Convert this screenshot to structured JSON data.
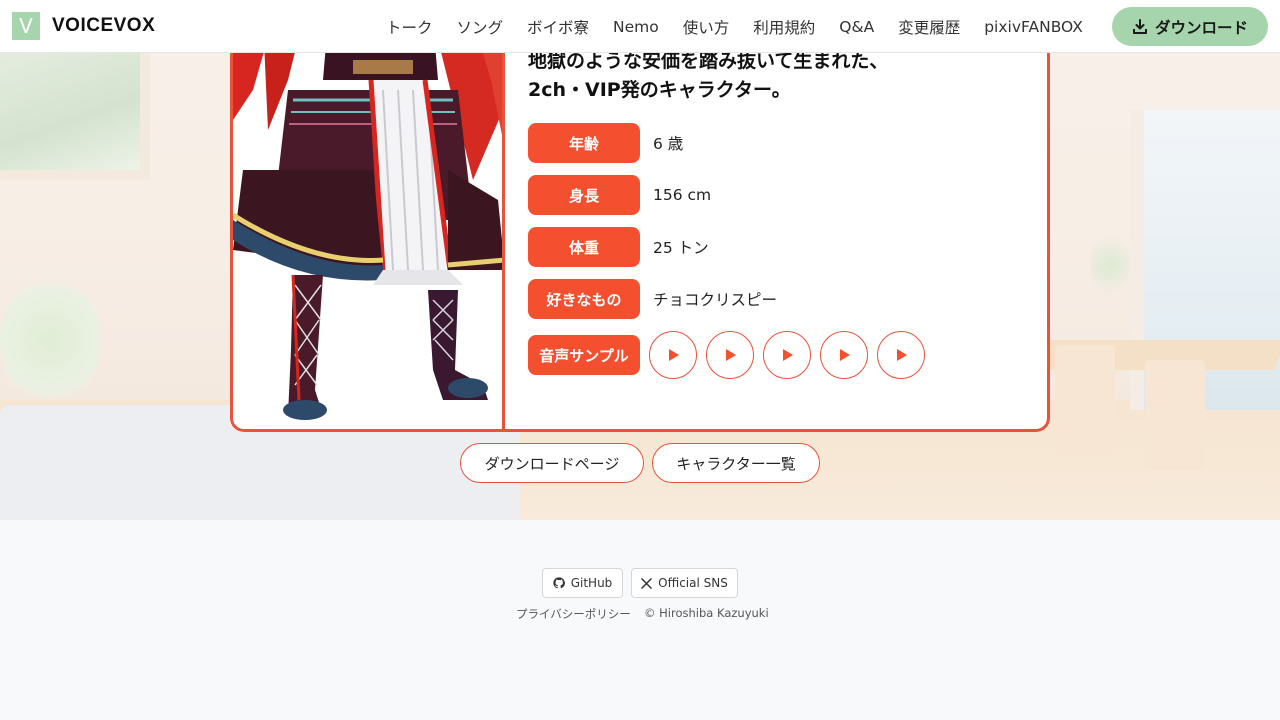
{
  "header": {
    "logo_letter": "V",
    "logo_text": "VOICEVOX",
    "nav": [
      "トーク",
      "ソング",
      "ボイボ寮",
      "Nemo",
      "使い方",
      "利用規約",
      "Q&A",
      "変更履歴",
      "pixivFANBOX"
    ],
    "download_label": "ダウンロード"
  },
  "character": {
    "intro_line1": "地獄のような安価を踏み抜いて生まれた、",
    "intro_line2": "2ch・VIP発のキャラクター。",
    "rows": [
      {
        "label": "年齢",
        "value": "6 歳"
      },
      {
        "label": "身長",
        "value": "156 cm"
      },
      {
        "label": "体重",
        "value": "25 トン"
      },
      {
        "label": "好きなもの",
        "value": "チョコクリスピー"
      }
    ],
    "samples_label": "音声サンプル",
    "sample_count": 5
  },
  "buttons": {
    "download_page": "ダウンロードページ",
    "character_list": "キャラクター一覧"
  },
  "footer": {
    "github": "GitHub",
    "official_sns": "Official SNS",
    "privacy": "プライバシーポリシー",
    "copyright": "© Hiroshiba Kazuyuki"
  },
  "colors": {
    "accent": "#f4502f",
    "brand_green": "#a5d4ad"
  }
}
